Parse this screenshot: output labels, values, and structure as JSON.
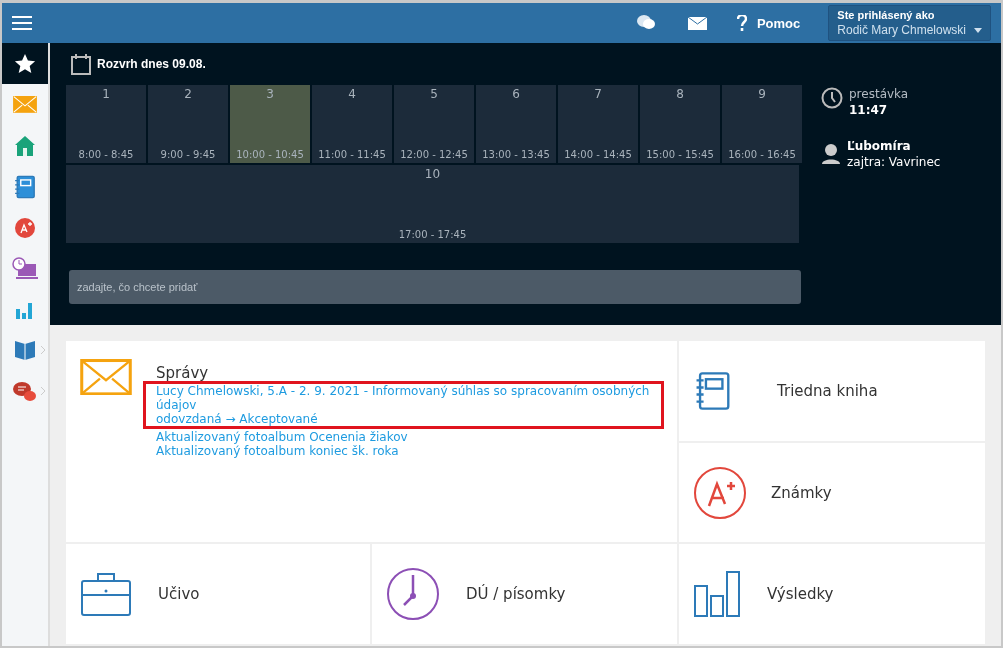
{
  "header": {
    "help": "Pomoc",
    "account": {
      "caption": "Ste prihlásený ako",
      "name": "Rodič Mary Chmelowski"
    }
  },
  "sidebar": {
    "items": [
      {
        "kind": "star",
        "selected": true,
        "submenu": false
      },
      {
        "kind": "mail",
        "selected": false,
        "submenu": false
      },
      {
        "kind": "home",
        "selected": false,
        "submenu": false
      },
      {
        "kind": "notebook",
        "selected": false,
        "submenu": false
      },
      {
        "kind": "grade",
        "selected": false,
        "submenu": false
      },
      {
        "kind": "clock",
        "selected": false,
        "submenu": false
      },
      {
        "kind": "chart",
        "selected": false,
        "submenu": false
      },
      {
        "kind": "book",
        "selected": false,
        "submenu": true
      },
      {
        "kind": "chat",
        "selected": false,
        "submenu": true
      }
    ]
  },
  "schedule": {
    "title": "Rozvrh dnes 09.08.",
    "lessons": [
      {
        "number": "1",
        "time": "8:00 - 8:45",
        "current": false
      },
      {
        "number": "2",
        "time": "9:00 - 9:45",
        "current": false
      },
      {
        "number": "3",
        "time": "10:00 - 10:45",
        "current": true
      },
      {
        "number": "4",
        "time": "11:00 - 11:45",
        "current": false
      },
      {
        "number": "5",
        "time": "12:00 - 12:45",
        "current": false
      },
      {
        "number": "6",
        "time": "13:00 - 13:45",
        "current": false
      },
      {
        "number": "7",
        "time": "14:00 - 14:45",
        "current": false
      },
      {
        "number": "8",
        "time": "15:00 - 15:45",
        "current": false
      },
      {
        "number": "9",
        "time": "16:00 - 16:45",
        "current": false
      },
      {
        "number": "10",
        "time": "17:00 - 17:45",
        "current": false
      }
    ],
    "add_field": {
      "placeholder": "zadajte, čo chcete pridať"
    }
  },
  "info": {
    "break_label": "prestávka",
    "break_time": "11:47",
    "nameday": "Ľubomíra",
    "tomorrow": "zajtra: Vavrinec"
  },
  "messages": {
    "title": "Správy",
    "items": [
      {
        "lines": [
          "Lucy Chmelowski, 5.A - 2. 9. 2021 - Informovaný súhlas so spracovaním osobných údajov",
          "odovzdaná → Akceptované"
        ],
        "highlighted": true
      },
      {
        "lines": [
          "Aktualizovaný fotoalbum Ocenenia žiakov"
        ],
        "highlighted": false
      },
      {
        "lines": [
          "Aktualizovaný fotoalbum koniec šk. roka"
        ],
        "highlighted": false
      }
    ]
  },
  "tiles": [
    {
      "kind": "notebook",
      "label": "Triedna kniha"
    },
    {
      "kind": "grade",
      "label": "Známky"
    },
    {
      "kind": "briefcase",
      "label": "Učivo"
    },
    {
      "kind": "clock",
      "label": "DÚ / písomky"
    },
    {
      "kind": "chart",
      "label": "Výsledky"
    }
  ]
}
